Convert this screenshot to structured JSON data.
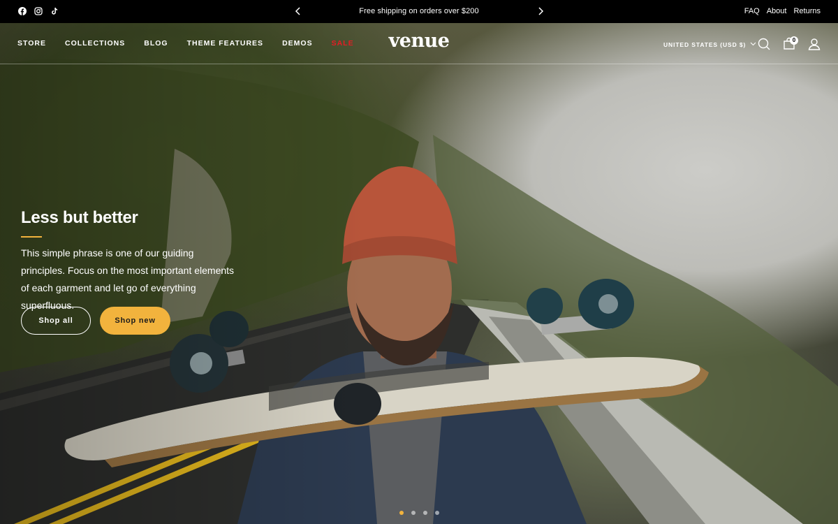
{
  "announcement": {
    "text": "Free shipping on orders over $200",
    "social_icons": [
      "facebook-icon",
      "instagram-icon",
      "tiktok-icon"
    ],
    "links": [
      "FAQ",
      "About",
      "Returns"
    ]
  },
  "header": {
    "logo": "venue",
    "nav": [
      "STORE",
      "COLLECTIONS",
      "BLOG",
      "THEME FEATURES",
      "DEMOS",
      "SALE"
    ],
    "currency": "UNITED STATES (USD $)",
    "cart_count": "0",
    "icons": [
      "search-icon",
      "cart-icon",
      "account-icon"
    ]
  },
  "hero": {
    "title": "Less but better",
    "text": "This simple phrase is one of our guiding principles. Focus on the most important elements of each garment and let go of everything superfluous.",
    "buttons": [
      "Shop all",
      "Shop new"
    ],
    "slides_total": 4,
    "active_slide": 1
  },
  "colors": {
    "accent": "#f2b33d",
    "sale": "#e51c23",
    "topbar_bg": "#000000",
    "text_light": "#ffffff"
  }
}
